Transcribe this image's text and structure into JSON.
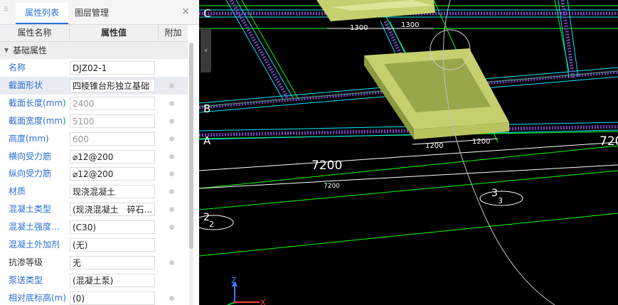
{
  "panel": {
    "tabs": [
      {
        "label": "属性列表",
        "active": true
      },
      {
        "label": "图层管理",
        "active": false
      }
    ],
    "close_label": "×",
    "header": {
      "col_name": "属性名称",
      "col_value": "属性值",
      "col_extra": "附加"
    },
    "group": {
      "label": "基础属性"
    },
    "rows": [
      {
        "name": "名称",
        "value": "DJZ02-1",
        "name_color": "blue",
        "value_gray": false,
        "checkbox": false,
        "selected": false
      },
      {
        "name": "截面形状",
        "value": "四棱锥台形独立基础",
        "name_color": "blue",
        "value_gray": false,
        "checkbox": true,
        "selected": true
      },
      {
        "name": "截面长度(mm)",
        "value": "2400",
        "name_color": "blue",
        "value_gray": true,
        "checkbox": true,
        "selected": false
      },
      {
        "name": "截面宽度(mm)",
        "value": "5100",
        "name_color": "blue",
        "value_gray": true,
        "checkbox": true,
        "selected": false
      },
      {
        "name": "高度(mm)",
        "value": "600",
        "name_color": "blue",
        "value_gray": true,
        "checkbox": true,
        "selected": false
      },
      {
        "name": "横向受力筋",
        "value": "⌀12@200",
        "name_color": "blue",
        "value_gray": false,
        "checkbox": true,
        "selected": false
      },
      {
        "name": "纵向受力筋",
        "value": "⌀12@200",
        "name_color": "blue",
        "value_gray": false,
        "checkbox": true,
        "selected": false
      },
      {
        "name": "材质",
        "value": "现浇混凝土",
        "name_color": "blue",
        "value_gray": false,
        "checkbox": true,
        "selected": false
      },
      {
        "name": "混凝土类型",
        "value": "(现浇混凝土　碎石...",
        "name_color": "blue",
        "value_gray": false,
        "checkbox": true,
        "selected": false
      },
      {
        "name": "混凝土强度...",
        "value": "(C30)",
        "name_color": "blue",
        "value_gray": false,
        "checkbox": true,
        "selected": false
      },
      {
        "name": "混凝土外加剂",
        "value": "(无)",
        "name_color": "blue",
        "value_gray": false,
        "checkbox": false,
        "selected": false
      },
      {
        "name": "抗渗等级",
        "value": "无",
        "name_color": "dark",
        "value_gray": false,
        "checkbox": true,
        "selected": false
      },
      {
        "name": "泵送类型",
        "value": "(混凝土泵)",
        "name_color": "blue",
        "value_gray": false,
        "checkbox": false,
        "selected": false
      },
      {
        "name": "相对底标高(m)",
        "value": "(0)",
        "name_color": "blue",
        "value_gray": false,
        "checkbox": true,
        "selected": false
      }
    ],
    "collapse_icon": "chevron-left-icon"
  },
  "cad": {
    "axis_labels": [
      "C",
      "B",
      "A"
    ],
    "dims_top": [
      "1300",
      "1300"
    ],
    "dims_mid": [
      "1200",
      "1200"
    ],
    "span_large": "7200",
    "span_small": "7200",
    "span_right": "720",
    "grid_bubble_3": "3",
    "grid_bubble_2": "2",
    "ucs_z": "Z",
    "ucs_x": "X",
    "colors": {
      "background": "#000000",
      "grid_line": "#00ff00",
      "beam_edge": "#00e5ff",
      "rebar": "#7b3fbf",
      "footing_top": "#c5cf6e",
      "footing_side": "#9aa64a",
      "footing_front": "#b8c35d",
      "dim_text": "#ffffff",
      "accent": "#2b6fd6"
    }
  }
}
